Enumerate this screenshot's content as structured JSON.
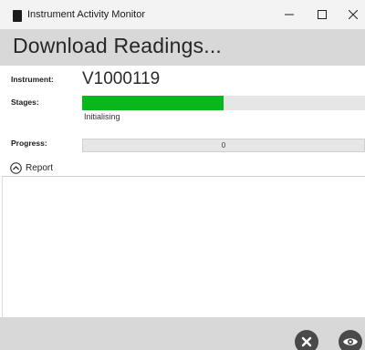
{
  "window": {
    "title": "Instrument Activity Monitor",
    "controls": {
      "minimize": "minimize-icon",
      "maximize": "maximize-icon",
      "close": "close-icon"
    }
  },
  "header": {
    "title": "Download Readings..."
  },
  "fields": {
    "instrument_label": "Instrument:",
    "instrument_value": "V1000119",
    "stages_label": "Stages:",
    "stage_status": "Initialising",
    "stage_progress_fraction": 0.5,
    "stage_fill_color": "#0ab61e",
    "progress_label": "Progress:",
    "progress_value": "0"
  },
  "report": {
    "label": "Report",
    "icon": "chevron-up-circle-icon",
    "expanded": true
  },
  "footer": {
    "cancel_icon": "cancel-circle-icon",
    "view_icon": "eye-icon"
  }
}
